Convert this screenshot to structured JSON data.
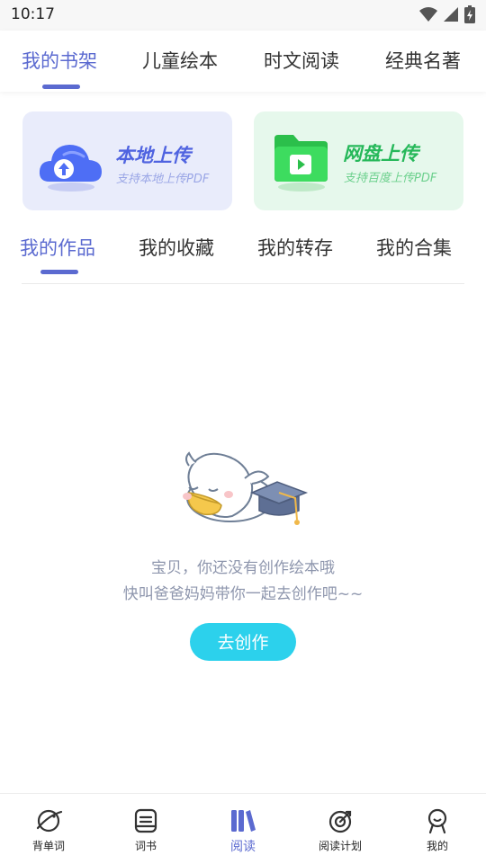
{
  "status_bar": {
    "time": "10:17"
  },
  "top_tabs": [
    {
      "label": "我的书架",
      "active": true
    },
    {
      "label": "儿童绘本",
      "active": false
    },
    {
      "label": "时文阅读",
      "active": false
    },
    {
      "label": "经典名著",
      "active": false
    }
  ],
  "upload_cards": {
    "local": {
      "title": "本地上传",
      "subtitle": "支持本地上传PDF",
      "icon": "cloud-upload-icon"
    },
    "cloud": {
      "title": "网盘上传",
      "subtitle": "支持百度上传PDF",
      "icon": "folder-play-icon"
    }
  },
  "sub_tabs": [
    {
      "label": "我的作品",
      "active": true
    },
    {
      "label": "我的收藏",
      "active": false
    },
    {
      "label": "我的转存",
      "active": false
    },
    {
      "label": "我的合集",
      "active": false
    }
  ],
  "empty_state": {
    "illustration": "sleeping-duck-graduation-cap",
    "line1": "宝贝，你还没有创作绘本哦",
    "line2": "快叫爸爸妈妈带你一起去创作吧~~",
    "button_label": "去创作"
  },
  "bottom_nav": [
    {
      "label": "背单词",
      "icon": "planet-icon",
      "active": false
    },
    {
      "label": "词书",
      "icon": "notebook-icon",
      "active": false
    },
    {
      "label": "阅读",
      "icon": "books-icon",
      "active": true
    },
    {
      "label": "阅读计划",
      "icon": "target-icon",
      "active": false
    },
    {
      "label": "我的",
      "icon": "profile-icon",
      "active": false
    }
  ],
  "colors": {
    "accent": "#5b6ad0",
    "button": "#2cd1ec",
    "local_card_bg": "#e9ecfb",
    "cloud_card_bg": "#e6f8ec",
    "empty_text": "#8e96ad"
  }
}
